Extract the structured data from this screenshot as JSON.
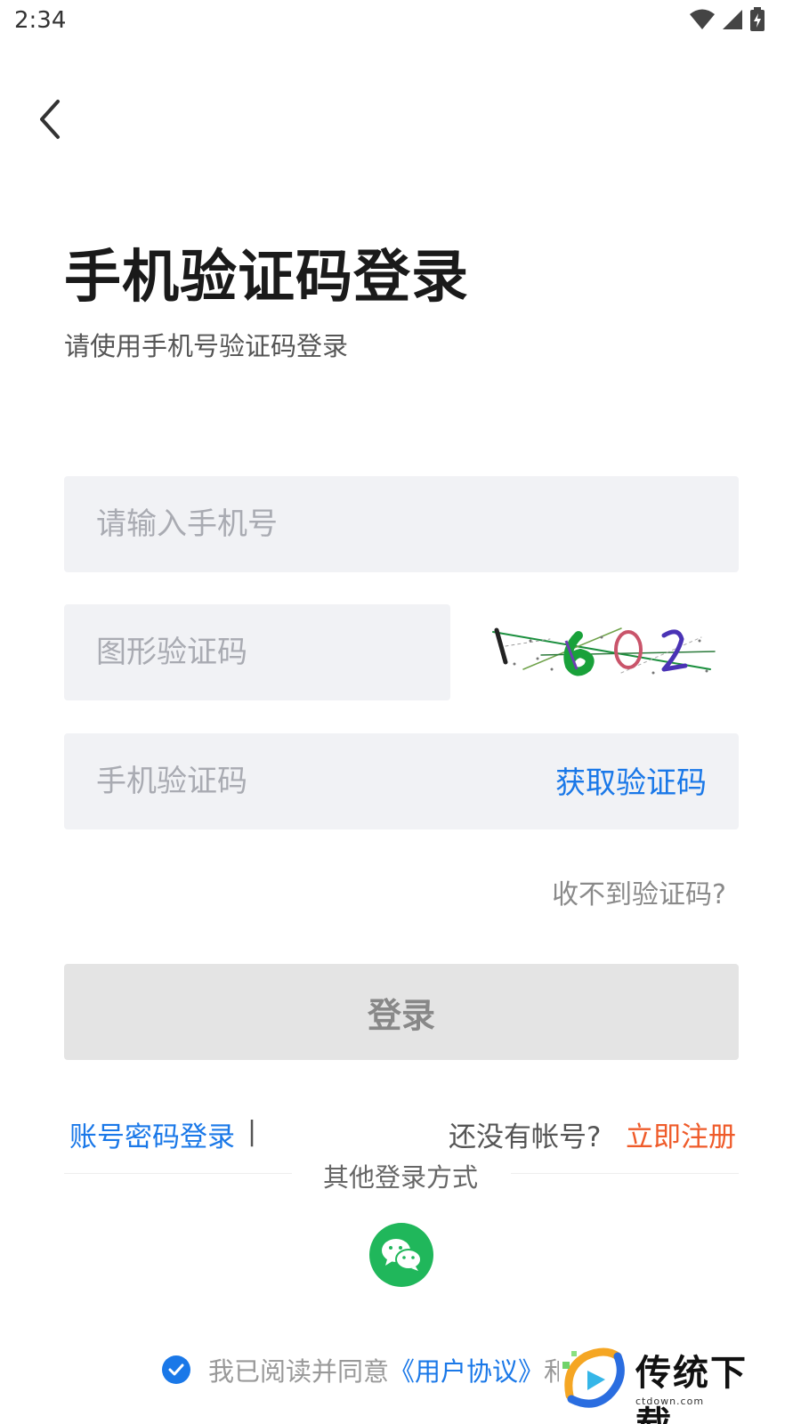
{
  "status_bar": {
    "time": "2:34"
  },
  "header": {
    "title": "手机验证码登录",
    "subtitle": "请使用手机号验证码登录"
  },
  "form": {
    "phone_placeholder": "请输入手机号",
    "captcha_placeholder": "图形验证码",
    "captcha_text": "1602",
    "sms_placeholder": "手机验证码",
    "get_code_label": "获取验证码",
    "no_code_label": "收不到验证码?",
    "login_label": "登录"
  },
  "links": {
    "password_login": "账号密码登录",
    "separator": "|",
    "no_account": "还没有帐号?",
    "register": "立即注册"
  },
  "other_login": {
    "label": "其他登录方式",
    "wechat_icon": "wechat-icon"
  },
  "agreement": {
    "prefix": "我已阅读并同意",
    "user_agreement": "《用户协议》",
    "suffix": "和"
  },
  "watermark": {
    "text": "传统下载",
    "sub": "ctdown.com"
  },
  "colors": {
    "accent": "#1a78e8",
    "register": "#ef5b2a",
    "wechat": "#20b75b",
    "field_bg": "#f1f2f5",
    "button_disabled": "#e4e4e4"
  }
}
